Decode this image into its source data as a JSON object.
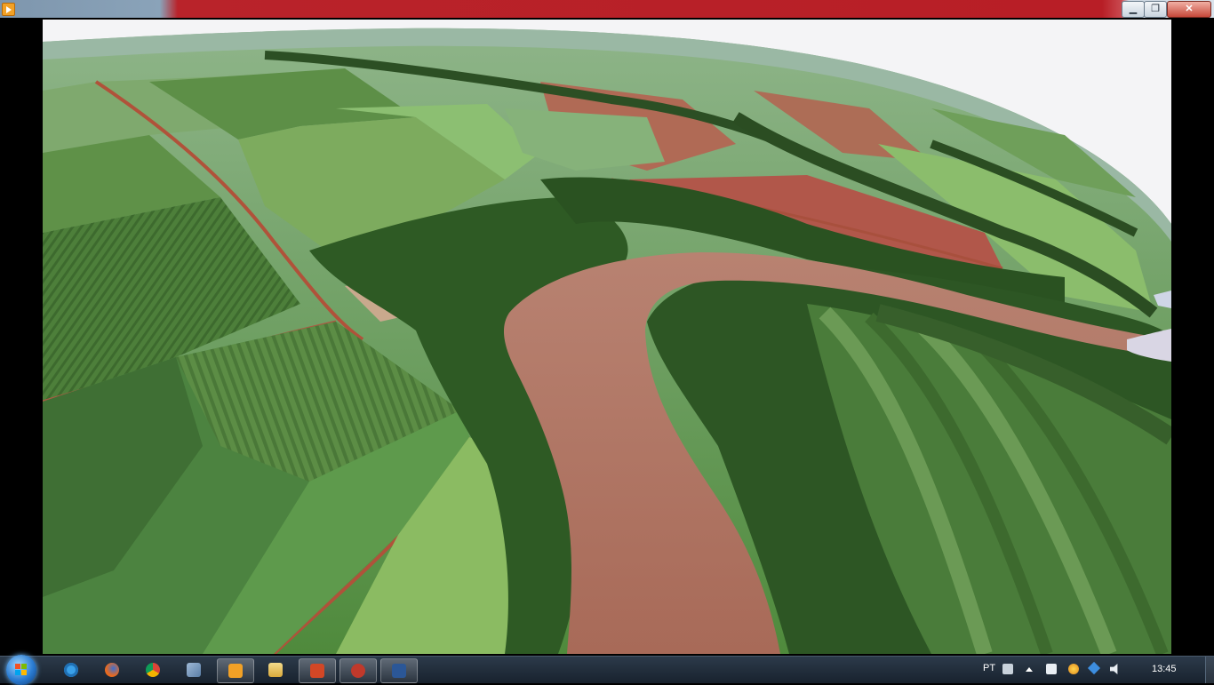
{
  "window": {
    "minimize_label": "▁",
    "maximize_label": "❐",
    "close_label": "✕",
    "app_icon": "media-player-icon"
  },
  "viewer": {
    "content": "aerial-photo-river-farmland"
  },
  "taskbar": {
    "pinned": [
      {
        "icon": "internet-explorer-icon",
        "color": "#3aa0e8"
      },
      {
        "icon": "firefox-icon",
        "color": "#e86a1f"
      },
      {
        "icon": "chrome-icon",
        "color": "#e8b41f"
      },
      {
        "icon": "paint-tool-icon",
        "color": "#6a8fb8"
      },
      {
        "icon": "media-player-icon",
        "color": "#f2a126"
      },
      {
        "icon": "file-explorer-icon",
        "color": "#e8c86a"
      },
      {
        "icon": "powerpoint-icon",
        "color": "#d24726"
      },
      {
        "icon": "app-sw-icon",
        "color": "#c0392b"
      },
      {
        "icon": "word-icon",
        "color": "#2b5797"
      }
    ],
    "tray": {
      "language": "PT",
      "time": "13:45"
    }
  },
  "colors": {
    "river": "#b07462",
    "forest": "#2f5a24",
    "field": "#6f9a4e",
    "soil": "#b0523a",
    "sky": "#f4f4f6"
  }
}
